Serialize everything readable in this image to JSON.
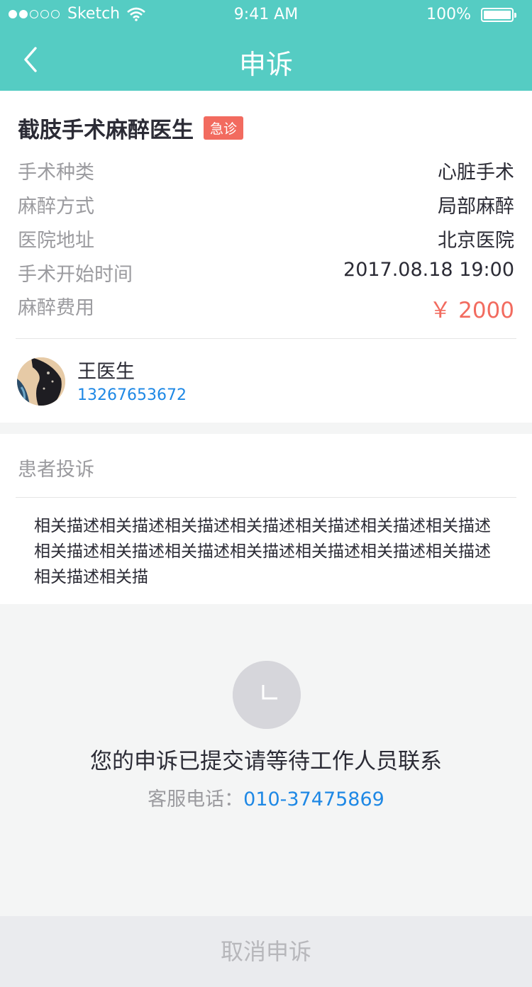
{
  "status_bar": {
    "carrier": "Sketch",
    "time": "9:41 AM",
    "battery": "100%"
  },
  "header": {
    "title": "申诉"
  },
  "job": {
    "title": "截肢手术麻醉医生",
    "tag": "急诊",
    "details": [
      {
        "label": "手术种类",
        "value": "心脏手术"
      },
      {
        "label": "麻醉方式",
        "value": "局部麻醉"
      },
      {
        "label": "医院地址",
        "value": "北京医院"
      },
      {
        "label": "手术开始时间",
        "value": "2017.08.18 19:00"
      },
      {
        "label": "麻醉费用",
        "value": "￥ 2000"
      }
    ]
  },
  "doctor": {
    "name": "王医生",
    "phone": "13267653672"
  },
  "complaint": {
    "heading": "患者投诉",
    "body": "相关描述相关描述相关描述相关描述相关描述相关描述相关描述相关描述相关描述相关描述相关描述相关描述相关描述相关描述相关描述相关描"
  },
  "submission": {
    "message": "您的申诉已提交请等待工作人员联系",
    "service_label": "客服电话：",
    "service_phone": "010-37475869"
  },
  "actions": {
    "cancel_label": "取消申诉"
  },
  "colors": {
    "brand": "#55ccc3",
    "accent": "#f26b5f",
    "link": "#1e88e5"
  }
}
